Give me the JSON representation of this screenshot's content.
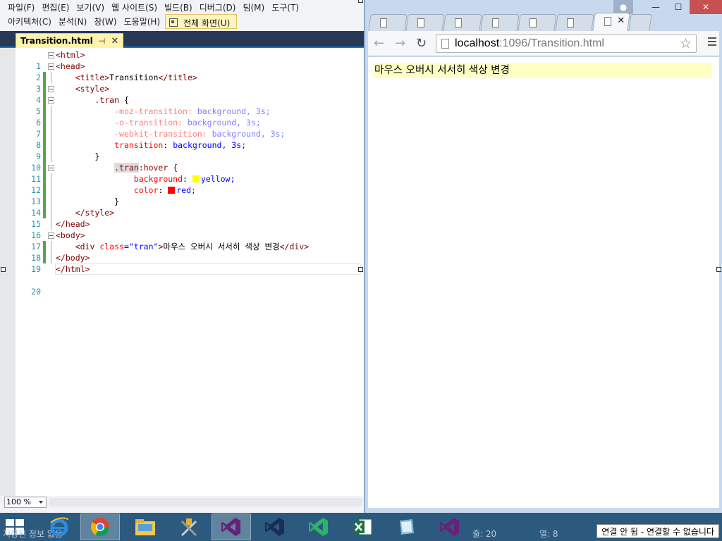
{
  "vs": {
    "menu1": [
      "파일(F)",
      "편집(E)",
      "보기(V)",
      "웹 사이트(S)",
      "빌드(B)",
      "디버그(D)",
      "팀(M)",
      "도구(T)"
    ],
    "menu2": [
      "아키텍처(C)",
      "분석(N)",
      "창(W)",
      "도움말(H)"
    ],
    "fullscreen_label": "전체 화면(U)",
    "tab_title": "Transition.html",
    "tab_pin": "⊣",
    "tab_close": "✕",
    "zoom": "100 %",
    "code_lines": [
      {
        "n": "1"
      },
      {
        "n": "2"
      },
      {
        "n": "3"
      },
      {
        "n": "4"
      },
      {
        "n": "5"
      },
      {
        "n": "6"
      },
      {
        "n": "7"
      },
      {
        "n": "8"
      },
      {
        "n": "9"
      },
      {
        "n": "10"
      },
      {
        "n": "11"
      },
      {
        "n": "12"
      },
      {
        "n": "13"
      },
      {
        "n": "14"
      },
      {
        "n": "15"
      },
      {
        "n": "16"
      },
      {
        "n": "17"
      },
      {
        "n": "18"
      },
      {
        "n": "19"
      },
      {
        "n": "20"
      }
    ],
    "code": {
      "l1": "<html>",
      "l2": "<head>",
      "l3_open": "<title>",
      "l3_text": "Transition",
      "l3_close": "</title>",
      "l4": "<style>",
      "l5_sel": ".tran",
      "l5_brace": " {",
      "l6_prop": "-moz-transition",
      "l6_val": " background, 3s;",
      "l7_prop": "-o-transition",
      "l7_val": " background, 3s;",
      "l8_prop": "-webkit-transition",
      "l8_val": " background, 3s;",
      "l9_prop": "transition",
      "l9_val": " background, 3s;",
      "l10": "}",
      "l11_sel": ".tran",
      "l11_rest": ":hover {",
      "l12_prop": "background",
      "l12_val": "yellow;",
      "l13_prop": "color",
      "l13_val": "red;",
      "l14": "}",
      "l15": "</style>",
      "l16": "</head>",
      "l17": "<body>",
      "l18_open": "<div",
      "l18_attr": " class",
      "l18_eq": "=",
      "l18_val": "\"tran\"",
      "l18_gt": ">",
      "l18_text": "마우스 오버시 서서히 색상 변경",
      "l18_close": "</div>",
      "l19": "</body>",
      "l20": "</html>",
      "colon": ":"
    }
  },
  "browser": {
    "url_host": "localhost",
    "url_path": ":1096/Transition.html",
    "back": "←",
    "forward": "→",
    "reload": "↻",
    "star": "☆",
    "tab_close": "✕",
    "page_text": "마우스 오버시 서서히 색상 변경"
  },
  "window_controls": {
    "minimize": "—",
    "maximize": "☐",
    "close": "✕"
  },
  "taskbar": {
    "faded_left": "저장된 정보 없음",
    "faded_line": "줄: 20",
    "faded_col": "열: 8",
    "notification": "연결 안 됨 - 연결할 수 없습니다"
  },
  "colors": {
    "yellow_swatch": "#ffff00",
    "red_swatch": "#ff0000",
    "hover_bg": "#ffffc4"
  }
}
